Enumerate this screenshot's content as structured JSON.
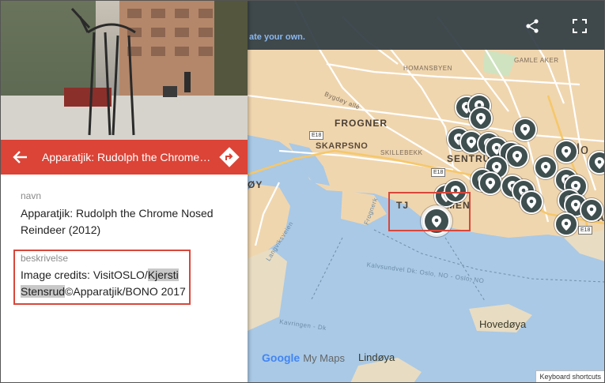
{
  "panel": {
    "title": "Apparatjik: Rudolph the Chrome …",
    "fields": [
      {
        "label": "navn",
        "value": "Apparatjik: Rudolph the Chrome Nosed Reindeer (2012)"
      },
      {
        "label": "beskrivelse",
        "value_parts": [
          "Image credits: VisitOSLO/",
          "Kjersti Stensrud",
          "©Apparatjik/BONO 2017"
        ]
      }
    ]
  },
  "map": {
    "top_subtitle": "ate your own.",
    "labels": {
      "homansbyen": "HOMANSBYEN",
      "gamle_aker": "GAMLE AKER",
      "skarpsno": "SKARPSNO",
      "frogner": "FROGNER",
      "skillebekk": "SKILLEBEKK",
      "sentrum": "SENTRU",
      "oy": "ØY",
      "tjuvholmen_left": "TJ",
      "tjuvholmen_right": "MEN",
      "bygdoy_alle": "Bygdøy allé",
      "hovedoya": "Hovedøya",
      "lindoya": "Lindøya",
      "lo": "lo",
      "gam": "GAM",
      "langviksveien": "Langviksveien",
      "water_route": "Kalvsundvel Dk: Oslo, NO - Oslo, NO",
      "kavringen": "Kavringen - Dk",
      "frognerkilen": "Frognerk"
    },
    "road_badges": [
      "E18",
      "E18",
      "E18"
    ],
    "google_logo": "Google",
    "my_maps": "My Maps",
    "keyboard_shortcuts": "Keyboard shortcuts"
  },
  "colors": {
    "header_red": "#db4437",
    "marker": "#3f4f4f",
    "water": "#a9c9e6",
    "land": "#f0d6ae",
    "annotation_box": "#d9463a"
  }
}
